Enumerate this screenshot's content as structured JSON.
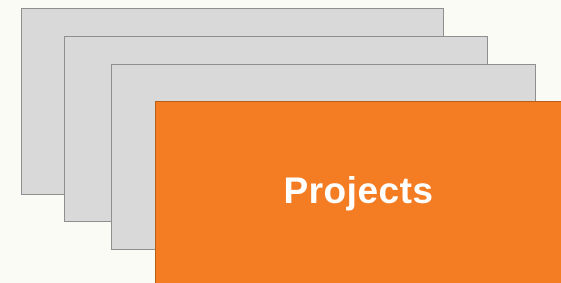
{
  "diagram": {
    "front_card": {
      "label": "Projects"
    }
  },
  "colors": {
    "background": "#fbfbf6",
    "back_card_fill": "#d9d9d9",
    "back_card_border": "#8f8f8f",
    "front_card_fill": "#f47c23"
  }
}
